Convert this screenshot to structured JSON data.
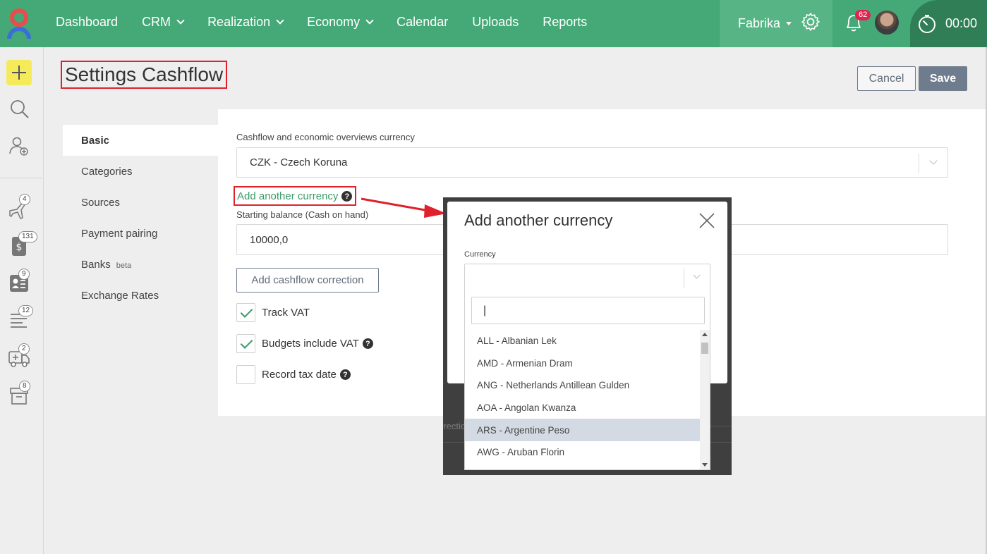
{
  "nav": {
    "items": [
      {
        "label": "Dashboard",
        "dropdown": false
      },
      {
        "label": "CRM",
        "dropdown": true
      },
      {
        "label": "Realization",
        "dropdown": true
      },
      {
        "label": "Economy",
        "dropdown": true
      },
      {
        "label": "Calendar",
        "dropdown": false
      },
      {
        "label": "Uploads",
        "dropdown": false
      },
      {
        "label": "Reports",
        "dropdown": false
      }
    ],
    "company": "Fabrika",
    "notification_count": "62",
    "timer": "00:00",
    "colors": {
      "bar": "#44a877",
      "company_bg": "#57b485",
      "timer_bg": "#2f7e56",
      "badge": "#e02450"
    }
  },
  "sidebar": {
    "badges": {
      "plane": "4",
      "invoice": "131",
      "contacts": "9",
      "list": "12",
      "vehicle": "2",
      "archive": "8"
    }
  },
  "page": {
    "title": "Settings Cashflow",
    "cancel_label": "Cancel",
    "save_label": "Save"
  },
  "settings_menu": {
    "items": [
      {
        "label": "Basic",
        "active": true
      },
      {
        "label": "Categories"
      },
      {
        "label": "Sources"
      },
      {
        "label": "Payment pairing"
      },
      {
        "label": "Banks",
        "tag": "beta"
      },
      {
        "label": "Exchange Rates"
      }
    ]
  },
  "form": {
    "currency_label": "Cashflow and economic overviews currency",
    "currency_value": "CZK - Czech Koruna",
    "add_currency_link": "Add another currency",
    "help_mark": "?",
    "starting_balance_label": "Starting balance (Cash on hand)",
    "starting_balance_value": "10000,0",
    "correction_button": "Add cashflow correction",
    "checks": [
      {
        "label": "Track VAT",
        "checked": true,
        "help": false
      },
      {
        "label": "Budgets include VAT",
        "checked": true,
        "help": true
      },
      {
        "label": "Record tax date",
        "checked": false,
        "help": true
      }
    ]
  },
  "modal": {
    "title": "Add another currency",
    "currency_label": "Currency",
    "search_value": "|",
    "options": [
      "ALL - Albanian Lek",
      "AMD - Armenian Dram",
      "ANG - Netherlands Antillean Gulden",
      "AOA - Angolan Kwanza",
      "ARS - Argentine Peso",
      "AWG - Aruban Florin"
    ],
    "highlighted_index": 4,
    "background_fragment": "rrectio"
  },
  "annotation": {
    "color": "#e0212c"
  }
}
